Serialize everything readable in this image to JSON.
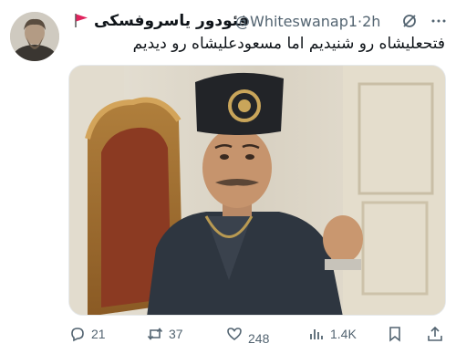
{
  "tweet": {
    "display_name": "فئودور یاسروفسکی",
    "handle": "@Whiteswanap1",
    "separator": "·",
    "time": "2h",
    "text": "فتحعلیشاه رو شنیدیم اما مسعودعلیشاه رو دیدیم"
  },
  "icons": {
    "flag": "red-flag-icon",
    "grok": "grok-icon",
    "more": "more-icon",
    "reply": "reply-icon",
    "retweet": "retweet-icon",
    "like": "heart-icon",
    "views": "views-icon",
    "bookmark": "bookmark-icon",
    "share": "share-icon"
  },
  "actions": {
    "replies": "21",
    "retweets": "37",
    "likes": "248",
    "views": "1.4K"
  },
  "colors": {
    "text_primary": "#0f1419",
    "text_secondary": "#536471",
    "flag_red": "#e0245e"
  }
}
